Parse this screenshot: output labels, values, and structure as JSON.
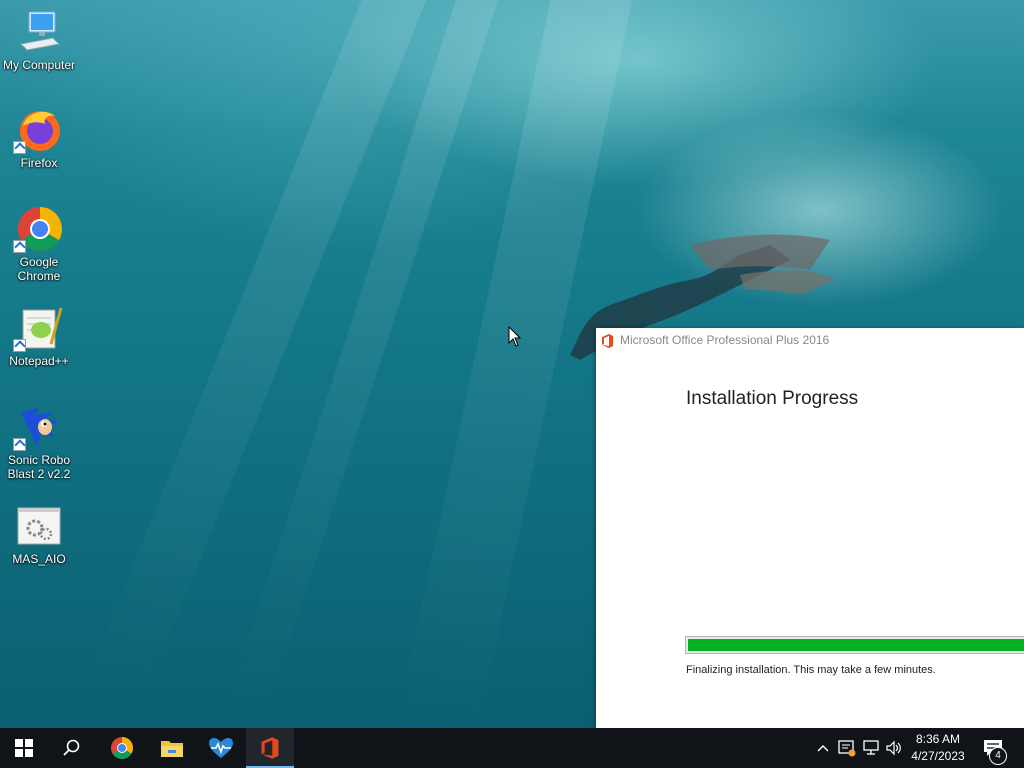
{
  "desktop": {
    "icons": [
      {
        "label": "My Computer",
        "icon": "computer-icon"
      },
      {
        "label": "Firefox",
        "icon": "firefox-icon"
      },
      {
        "label": "Google Chrome",
        "icon": "chrome-icon"
      },
      {
        "label": "Notepad++",
        "icon": "notepadpp-icon"
      },
      {
        "label": "Sonic Robo Blast 2 v2.2",
        "icon": "sonic-icon"
      },
      {
        "label": "MAS_AIO",
        "icon": "batch-script-icon"
      }
    ]
  },
  "installer": {
    "title": "Microsoft Office Professional Plus 2016",
    "heading": "Installation Progress",
    "progress": 0.99,
    "status": "Finalizing installation. This may take a few minutes.",
    "progress_color": "#06b025"
  },
  "taskbar": {
    "pinned": [
      {
        "name": "start-button",
        "icon": "windows-logo-icon"
      },
      {
        "name": "search-button",
        "icon": "search-icon"
      },
      {
        "name": "chrome",
        "icon": "chrome-icon"
      },
      {
        "name": "file-explorer",
        "icon": "folder-icon"
      },
      {
        "name": "activity-monitor",
        "icon": "heartbeat-icon"
      },
      {
        "name": "office-setup",
        "icon": "office-icon",
        "active": true
      }
    ],
    "clock": {
      "time": "8:36 AM",
      "date": "4/27/2023"
    },
    "notification_count": "4"
  }
}
